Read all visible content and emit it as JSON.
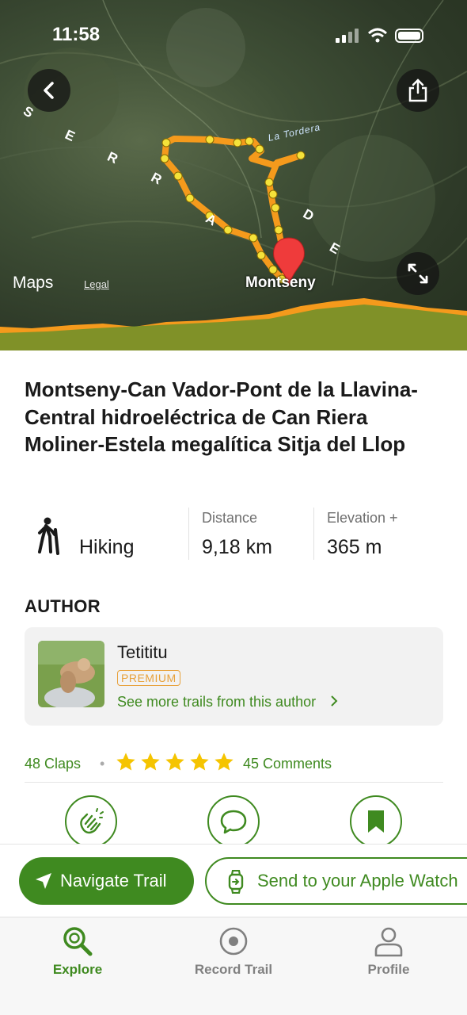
{
  "status_bar": {
    "time": "11:58"
  },
  "map": {
    "maps_logo": "Maps",
    "legal": "Legal",
    "place_label": "Montseny",
    "river_label": "La Tordera",
    "range_letters": [
      "S",
      "E",
      "R",
      "R",
      "A",
      "D",
      "E"
    ]
  },
  "trail": {
    "title": "Montseny-Can Vador-Pont de la Llavina-Central hidroeléctrica de Can Riera Moliner-Estela megalítica Sitja del Llop",
    "activity": "Hiking",
    "distance_label": "Distance",
    "distance_value": "9,18 km",
    "elevation_label": "Elevation +",
    "elevation_value": "365 m"
  },
  "author": {
    "heading": "AUTHOR",
    "name": "Tetititu",
    "badge": "PREMIUM",
    "more_link": "See more trails from this author"
  },
  "social": {
    "claps": "48 Claps",
    "rating_stars": 5,
    "comments": "45 Comments"
  },
  "actions": {
    "navigate": "Navigate Trail",
    "watch": "Send to your Apple Watch"
  },
  "tabs": [
    {
      "label": "Explore",
      "active": true
    },
    {
      "label": "Record Trail",
      "active": false
    },
    {
      "label": "Profile",
      "active": false
    }
  ],
  "colors": {
    "brand_green": "#3f8a20",
    "route_orange": "#f59a1c",
    "premium": "#e8a13a",
    "star": "#f5c400"
  }
}
